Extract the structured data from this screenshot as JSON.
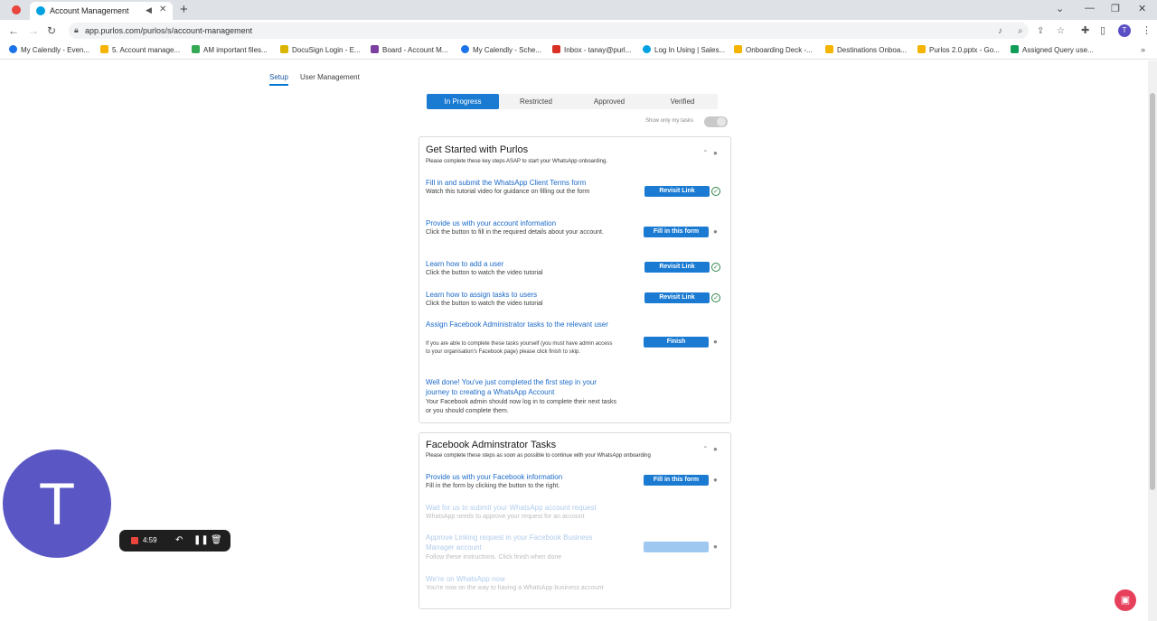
{
  "browser": {
    "tab_title": "Account Management",
    "url": "app.purlos.com/purlos/s/account-management",
    "bookmarks": [
      {
        "label": "My Calendly - Even...",
        "color": "#1a73e8"
      },
      {
        "label": "5. Account manage...",
        "color": "#f4b400"
      },
      {
        "label": "AM important files...",
        "color": "#34a853"
      },
      {
        "label": "DocuSign Login - E...",
        "color": "#d9b500"
      },
      {
        "label": "Board - Account M...",
        "color": "#7b3fa0"
      },
      {
        "label": "My Calendly - Sche...",
        "color": "#1a73e8"
      },
      {
        "label": "Inbox - tanay@purl...",
        "color": "#d93025"
      },
      {
        "label": "Log In Using | Sales...",
        "color": "#00a1e0"
      },
      {
        "label": "Onboarding Deck -...",
        "color": "#f4b400"
      },
      {
        "label": "Destinations Onboa...",
        "color": "#f4b400"
      },
      {
        "label": "Purlos 2.0.pptx - Go...",
        "color": "#f4b400"
      },
      {
        "label": "Assigned Query use...",
        "color": "#0f9d58"
      }
    ]
  },
  "subnav": {
    "setup": "Setup",
    "user_management": "User Management"
  },
  "status_tabs": [
    "In Progress",
    "Restricted",
    "Approved",
    "Verified"
  ],
  "show_only_my_tasks": "Show only my tasks",
  "get_started": {
    "title": "Get Started with Purlos",
    "subtitle": "Please complete these key steps ASAP to start your WhatsApp onboarding.",
    "tasks": [
      {
        "title": "Fill in and submit the WhatsApp Client Terms form",
        "desc": "Watch this tutorial video for guidance on filling out the form",
        "button": "Revisit Link"
      },
      {
        "title": "Provide us with your account information",
        "desc": "Click the button to fill in the required details about your account.",
        "button": "Fill in this form"
      },
      {
        "title": "Learn how to add a user",
        "desc": "Click the button to watch the video tutorial",
        "button": "Revisit Link"
      },
      {
        "title": "Learn how to assign tasks to users",
        "desc": "Click the button to watch the video tutorial",
        "button": "Revisit Link"
      },
      {
        "title": "Assign Facebook Administrator tasks to the relevant user",
        "desc": "If you are able to complete these tasks yourself (you must have admin access to your organisation's Facebook page) please click finish to skip.",
        "button": "Finish"
      },
      {
        "title": "Well done! You've just completed the first step in your journey to creating a WhatsApp Account",
        "desc": "Your Facebook admin should now log in to complete their next tasks or you should complete them."
      }
    ]
  },
  "fb_admin": {
    "title": "Facebook Adminstrator Tasks",
    "subtitle": "Please complete these steps as soon as possible to continue with your WhatsApp onboarding",
    "tasks": [
      {
        "title": "Provide us with your Facebook information",
        "desc": "Fill in the form by clicking the button to the right.",
        "button": "Fill in this form"
      },
      {
        "title": "Wait for us to submit your WhatsApp account request",
        "desc": "WhatsApp needs to approve your request for an account"
      },
      {
        "title": "Approve Linking request in your Facebook Business Manager account",
        "desc": "Follow these instructions. Click finish when done",
        "button": "Finish"
      },
      {
        "title": "We're on WhatsApp now",
        "desc": "You're now on the way to having a WhatsApp business account"
      }
    ]
  },
  "recorder": {
    "time": "4:59"
  },
  "webcam_initial": "T",
  "profile_initial": "T"
}
